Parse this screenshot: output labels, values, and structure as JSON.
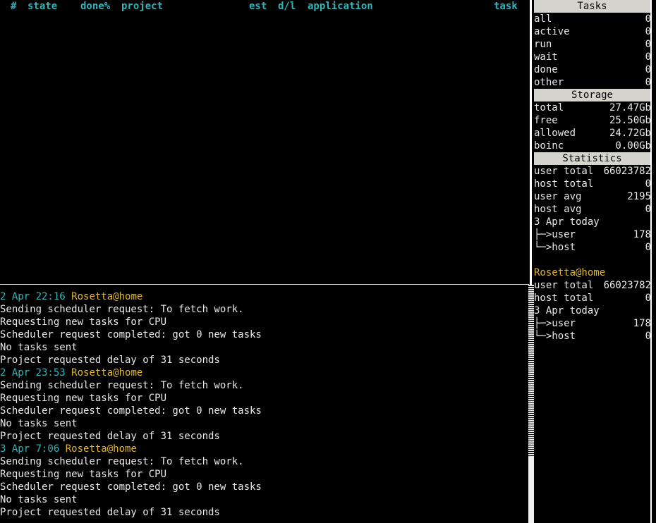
{
  "task_table": {
    "columns": {
      "num": "#",
      "state": "state",
      "done": "done%",
      "project": "project",
      "est": "est",
      "dl": "d/l",
      "application": "application",
      "task": "task"
    }
  },
  "messages": [
    {
      "type": "header",
      "time": "2 Apr 22:16",
      "project": "Rosetta@home"
    },
    {
      "type": "text",
      "text": "Sending scheduler request: To fetch work."
    },
    {
      "type": "text",
      "text": "Requesting new tasks for CPU"
    },
    {
      "type": "text",
      "text": "Scheduler request completed: got 0 new tasks"
    },
    {
      "type": "text",
      "text": "No tasks sent"
    },
    {
      "type": "text",
      "text": "Project requested delay of 31 seconds"
    },
    {
      "type": "header",
      "time": "2 Apr 23:53",
      "project": "Rosetta@home"
    },
    {
      "type": "text",
      "text": "Sending scheduler request: To fetch work."
    },
    {
      "type": "text",
      "text": "Requesting new tasks for CPU"
    },
    {
      "type": "text",
      "text": "Scheduler request completed: got 0 new tasks"
    },
    {
      "type": "text",
      "text": "No tasks sent"
    },
    {
      "type": "text",
      "text": "Project requested delay of 31 seconds"
    },
    {
      "type": "header",
      "time": "3 Apr 7:06",
      "project": "Rosetta@home"
    },
    {
      "type": "text",
      "text": "Sending scheduler request: To fetch work."
    },
    {
      "type": "text",
      "text": "Requesting new tasks for CPU"
    },
    {
      "type": "text",
      "text": "Scheduler request completed: got 0 new tasks"
    },
    {
      "type": "text",
      "text": "No tasks sent"
    },
    {
      "type": "text",
      "text": "Project requested delay of 31 seconds"
    }
  ],
  "sidebar": {
    "tasks": {
      "title": "Tasks",
      "rows": [
        {
          "label": "all",
          "value": "0"
        },
        {
          "label": "active",
          "value": "0"
        },
        {
          "label": "run",
          "value": "0"
        },
        {
          "label": "wait",
          "value": "0"
        },
        {
          "label": "done",
          "value": "0"
        },
        {
          "label": "other",
          "value": "0"
        }
      ]
    },
    "storage": {
      "title": "Storage",
      "rows": [
        {
          "label": "total",
          "value": "27.47Gb"
        },
        {
          "label": "free",
          "value": "25.50Gb"
        },
        {
          "label": "allowed",
          "value": "24.72Gb"
        },
        {
          "label": "boinc",
          "value": "0.00Gb"
        }
      ]
    },
    "statistics": {
      "title": "Statistics",
      "rows": [
        {
          "label": "user total",
          "value": "66023782"
        },
        {
          "label": "host total",
          "value": "0"
        },
        {
          "label": "user avg",
          "value": "2195"
        },
        {
          "label": "host avg",
          "value": "0"
        }
      ],
      "today_label": "3 Apr today",
      "today_user_label": "user",
      "today_user_value": "178",
      "today_host_label": "host",
      "today_host_value": "0",
      "tree_mid": "├─>",
      "tree_end": "└─>"
    },
    "project_stats": {
      "name": "Rosetta@home",
      "rows": [
        {
          "label": "user total",
          "value": "66023782"
        },
        {
          "label": "host total",
          "value": "0"
        }
      ],
      "today_label": "3 Apr today",
      "today_user_label": "user",
      "today_user_value": "178",
      "today_host_label": "host",
      "today_host_value": "0",
      "tree_mid": "├─>",
      "tree_end": "└─>"
    }
  }
}
